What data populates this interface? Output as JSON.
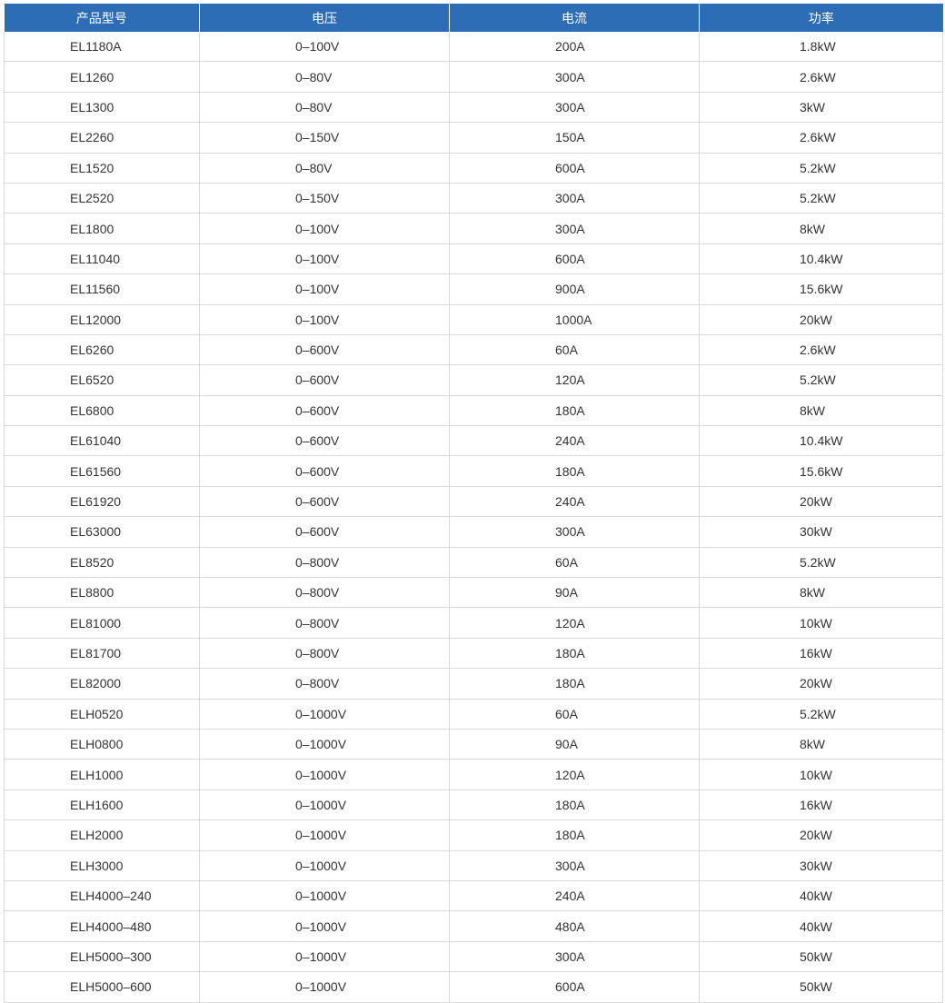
{
  "table": {
    "headers": [
      "产品型号",
      "电压",
      "电流",
      "功率"
    ],
    "rows": [
      [
        "EL1180A",
        "0–100V",
        "200A",
        "1.8kW"
      ],
      [
        "EL1260",
        "0–80V",
        "300A",
        "2.6kW"
      ],
      [
        "EL1300",
        "0–80V",
        "300A",
        "3kW"
      ],
      [
        "EL2260",
        "0–150V",
        "150A",
        "2.6kW"
      ],
      [
        "EL1520",
        "0–80V",
        "600A",
        "5.2kW"
      ],
      [
        "EL2520",
        "0–150V",
        "300A",
        "5.2kW"
      ],
      [
        "EL1800",
        "0–100V",
        "300A",
        "8kW"
      ],
      [
        "EL11040",
        "0–100V",
        "600A",
        "10.4kW"
      ],
      [
        "EL11560",
        "0–100V",
        "900A",
        "15.6kW"
      ],
      [
        "EL12000",
        "0–100V",
        "1000A",
        "20kW"
      ],
      [
        "EL6260",
        "0–600V",
        "60A",
        "2.6kW"
      ],
      [
        "EL6520",
        "0–600V",
        "120A",
        "5.2kW"
      ],
      [
        "EL6800",
        "0–600V",
        "180A",
        "8kW"
      ],
      [
        "EL61040",
        "0–600V",
        "240A",
        "10.4kW"
      ],
      [
        "EL61560",
        "0–600V",
        "180A",
        "15.6kW"
      ],
      [
        "EL61920",
        "0–600V",
        "240A",
        "20kW"
      ],
      [
        "EL63000",
        "0–600V",
        "300A",
        "30kW"
      ],
      [
        "EL8520",
        "0–800V",
        "60A",
        "5.2kW"
      ],
      [
        "EL8800",
        "0–800V",
        "90A",
        "8kW"
      ],
      [
        "EL81000",
        "0–800V",
        "120A",
        "10kW"
      ],
      [
        "EL81700",
        "0–800V",
        "180A",
        "16kW"
      ],
      [
        "EL82000",
        "0–800V",
        "180A",
        "20kW"
      ],
      [
        "ELH0520",
        "0–1000V",
        "60A",
        "5.2kW"
      ],
      [
        "ELH0800",
        "0–1000V",
        "90A",
        "8kW"
      ],
      [
        "ELH1000",
        "0–1000V",
        "120A",
        "10kW"
      ],
      [
        "ELH1600",
        "0–1000V",
        "180A",
        "16kW"
      ],
      [
        "ELH2000",
        "0–1000V",
        "180A",
        "20kW"
      ],
      [
        "ELH3000",
        "0–1000V",
        "300A",
        "30kW"
      ],
      [
        "ELH4000–240",
        "0–1000V",
        "240A",
        "40kW"
      ],
      [
        "ELH4000–480",
        "0–1000V",
        "480A",
        "40kW"
      ],
      [
        "ELH5000–300",
        "0–1000V",
        "300A",
        "50kW"
      ],
      [
        "ELH5000–600",
        "0–1000V",
        "600A",
        "50kW"
      ]
    ]
  },
  "colors": {
    "header_bg": "#2d6db5",
    "header_text": "#ffffff",
    "border": "#d9d9d9",
    "body_text": "#333333"
  }
}
